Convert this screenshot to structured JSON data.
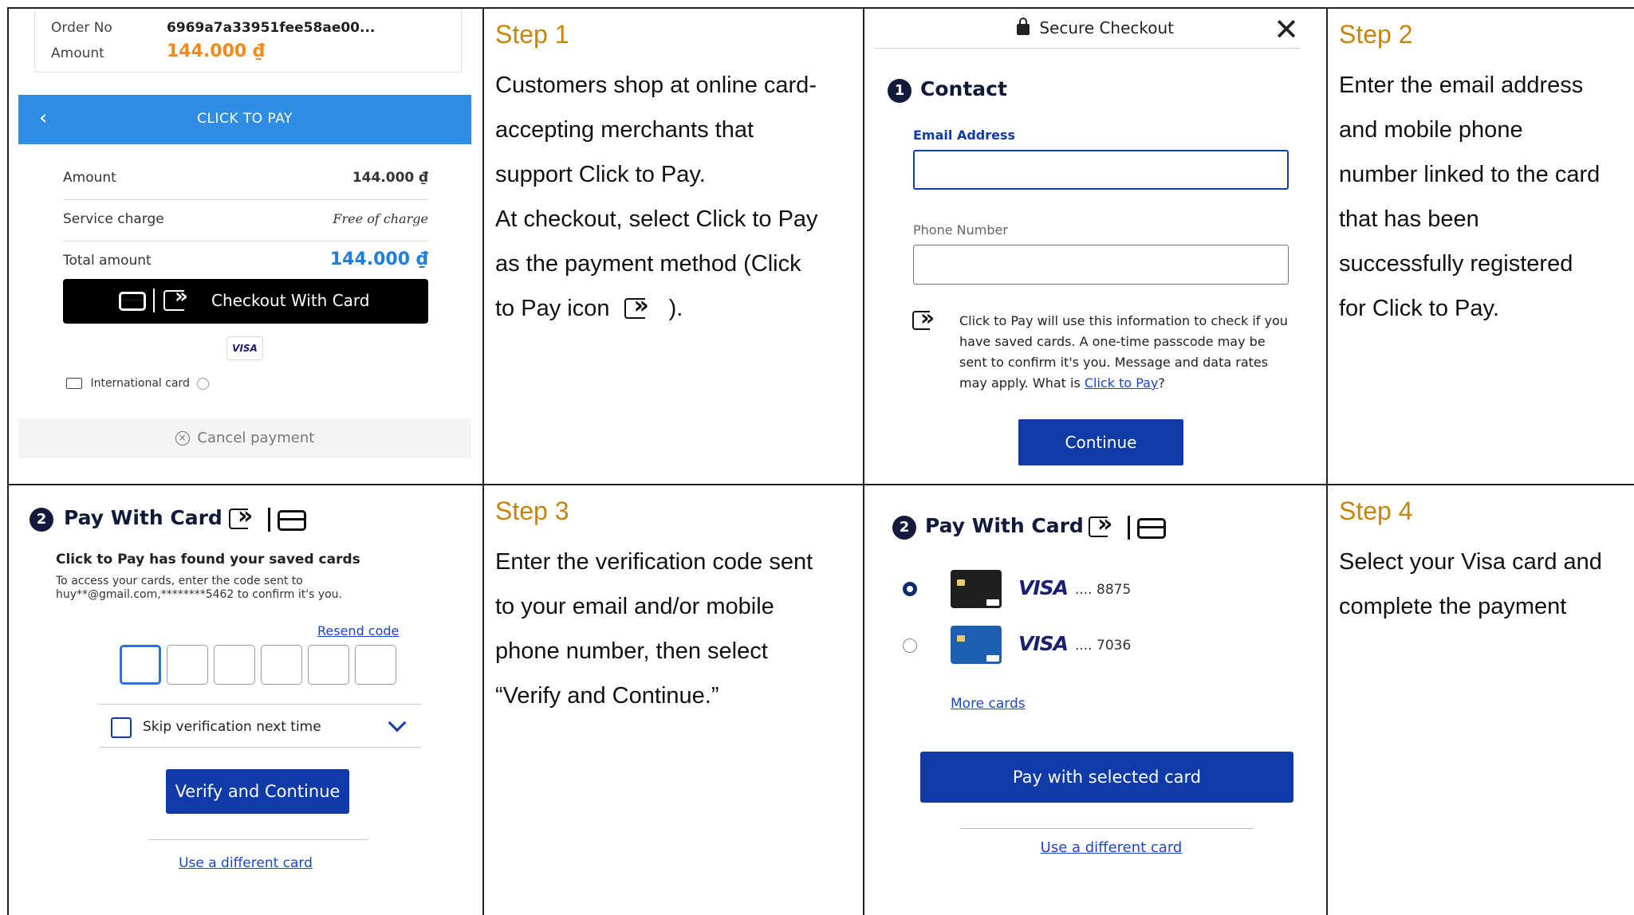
{
  "panel1": {
    "order_no_label": "Order No",
    "order_no_value": "6969a7a33951fee58ae00...",
    "amount_label": "Amount",
    "amount_value": "144.000 ₫",
    "header_title": "CLICK TO PAY",
    "rows": [
      {
        "label": "Amount",
        "value": "144.000 ₫"
      },
      {
        "label": "Service charge",
        "value": "Free of charge"
      },
      {
        "label": "Total amount",
        "value": "144.000 ₫"
      }
    ],
    "checkout_button": "Checkout With Card",
    "visa_badge": "VISA",
    "international_card": "International card",
    "cancel": "Cancel payment"
  },
  "step1": {
    "title": "Step 1",
    "lines": [
      "Customers shop at online card-",
      "accepting merchants that",
      "support Click to Pay.",
      "At checkout, select Click to Pay",
      "as the payment method (Click",
      "to Pay icon",
      ")."
    ]
  },
  "panel3": {
    "header": "Secure Checkout",
    "step_number": "1",
    "heading": "Contact",
    "email_label": "Email Address",
    "phone_label": "Phone Number",
    "note_text": "Click to Pay will use this information to check if you have saved cards. A one-time passcode may be sent to confirm it's you. Message and data rates may apply. What is ",
    "note_link": "Click to Pay",
    "note_end": "?",
    "continue_button": "Continue"
  },
  "step2": {
    "title": "Step 2",
    "lines": [
      "Enter the email address",
      "and mobile phone",
      "number linked to the card",
      "that has been",
      "successfully registered",
      "for Click to Pay."
    ]
  },
  "panel5": {
    "step_number": "2",
    "heading": "Pay With Card",
    "found": "Click to Pay has found your saved cards",
    "instr_line1": "To access your cards, enter the code sent to",
    "instr_line2": "huy**@gmail.com,********5462 to confirm it's you.",
    "resend": "Resend code",
    "skip": "Skip verification next time",
    "verify_button": "Verify and Continue",
    "different_card": "Use a different card"
  },
  "step3": {
    "title": "Step 3",
    "lines": [
      "Enter the verification code sent",
      "to your email and/or mobile",
      "phone number, then select",
      "“Verify and Continue.”"
    ]
  },
  "panel7": {
    "step_number": "2",
    "heading": "Pay With Card",
    "cards": [
      {
        "brand": "VISA",
        "last4": ".... 8875",
        "selected": true,
        "color": "#1e1e1e"
      },
      {
        "brand": "VISA",
        "last4": ".... 7036",
        "selected": false,
        "color": "#1d5fb0"
      }
    ],
    "more_cards": "More cards",
    "pay_button": "Pay with selected card",
    "different_card": "Use a different card"
  },
  "step4": {
    "title": "Step 4",
    "lines": [
      "Select your Visa card and",
      "complete the payment"
    ]
  },
  "colors": {
    "step_title": "#c5860b",
    "primary_blue": "#0f3aa8",
    "header_blue": "#2f8de4",
    "amount_orange": "#f08a1c",
    "total_blue": "#1e7ee0"
  }
}
